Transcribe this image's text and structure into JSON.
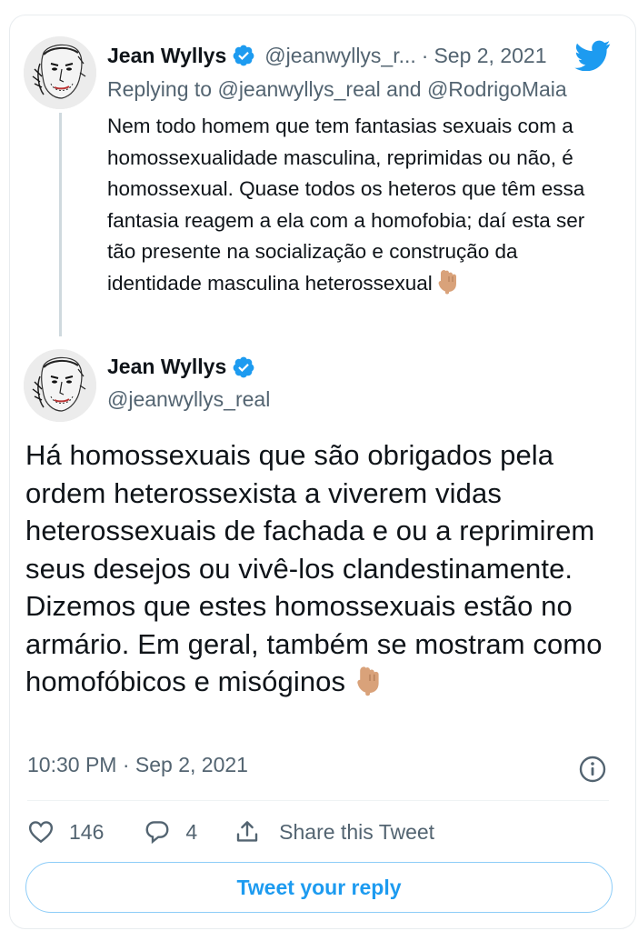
{
  "colors": {
    "accent": "#1d9bf0",
    "text_primary": "#0f1419",
    "text_secondary": "#536471",
    "verified_badge": "#1d9bf0",
    "thread_line": "#cfd9de"
  },
  "parent_tweet": {
    "author_name": "Jean Wyllys",
    "author_handle": "@jeanwyllys_r...",
    "date": "Sep 2, 2021",
    "separator": "·",
    "replying_prefix": "Replying to",
    "replying_mention_1": "@jeanwyllys_real",
    "replying_and": "and",
    "replying_mention_2": "@RodrigoMaia",
    "text": "Nem todo homem que tem fantasias sexuais com a homossexualidade masculina, reprimidas ou não, é homossexual. Quase todos os heteros que têm essa fantasia reagem a ela com a homofobia; daí esta ser tão presente na socialização  e construção da identidade masculina heterossexual",
    "icons": [
      "avatar",
      "verified-badge-icon",
      "twitter-logo-icon",
      "backhand-index-pointing-down-icon"
    ]
  },
  "main_tweet": {
    "author_name": "Jean Wyllys",
    "author_handle": "@jeanwyllys_real",
    "text": "Há homossexuais que são obrigados pela ordem heterossexista a viverem vidas heterossexuais de fachada e ou a reprimirem seus desejos ou vivê-los clandestinamente. Dizemos que estes homossexuais estão no armário. Em geral, também se mostram como homofóbicos e misóginos",
    "timestamp": "10:30 PM · Sep 2, 2021",
    "icons": [
      "avatar",
      "verified-badge-icon",
      "backhand-index-pointing-down-icon",
      "info-icon"
    ]
  },
  "actions": {
    "like_count": "146",
    "reply_count": "4",
    "share_label": "Share this Tweet",
    "icons": [
      "heart-icon",
      "reply-bubble-icon",
      "share-icon"
    ]
  },
  "reply_button": {
    "label": "Tweet your reply"
  }
}
